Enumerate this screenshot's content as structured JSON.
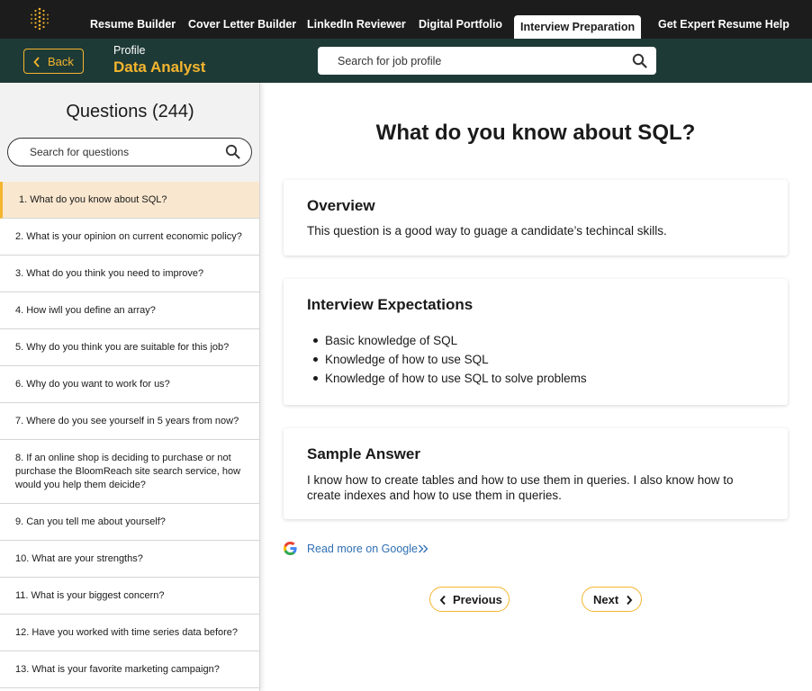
{
  "nav": {
    "items": [
      "Resume Builder",
      "Cover Letter Builder",
      "LinkedIn Reviewer",
      "Digital Portfolio",
      "Interview Preparation",
      "Get Expert Resume Help"
    ],
    "active": "Interview Preparation"
  },
  "subheader": {
    "back_label": "Back",
    "profile_label": "Profile",
    "profile_title": "Data Analyst",
    "search_placeholder": "Search for job profile"
  },
  "sidebar": {
    "title": "Questions (244)",
    "search_placeholder": "Search for questions",
    "questions": [
      "1. What do you know about SQL?",
      "2. What is your opinion on current economic policy?",
      "3. What do you think you need to improve?",
      "4. How iwll you define an array?",
      "5. Why do you think you are suitable for this job?",
      "6. Why do you want to work for us?",
      "7. Where do you see yourself in 5 years from now?",
      "8. If an online shop is deciding to purchase or not purchase the BloomReach site search service, how would you help them deicide?",
      "9. Can you tell me about yourself?",
      "10. What are your strengths?",
      "11. What is your biggest concern?",
      "12. Have you worked with time series data before?",
      "13. What is your favorite marketing campaign?"
    ],
    "active_index": 0
  },
  "main": {
    "question_title": "What do you know about SQL?",
    "overview": {
      "heading": "Overview",
      "text": "This question is a good way to guage a candidate’s techincal skills."
    },
    "expectations": {
      "heading": "Interview Expectations",
      "items": [
        "Basic knowledge of SQL",
        "Knowledge of how to use SQL",
        "Knowledge of how to use SQL to solve problems"
      ]
    },
    "sample_answer": {
      "heading": "Sample Answer",
      "text": "I know how to create tables and how to use them in queries. I also know how to create indexes and how to use them in queries."
    },
    "google_link": "Read more on Google",
    "previous_label": "Previous",
    "next_label": "Next"
  },
  "colors": {
    "accent": "#f5b52e",
    "nav_bg": "#1c1c1c",
    "subheader_bg": "#1e3a36",
    "active_question_bg": "#f9e7cf",
    "link": "#2f6fb2"
  }
}
